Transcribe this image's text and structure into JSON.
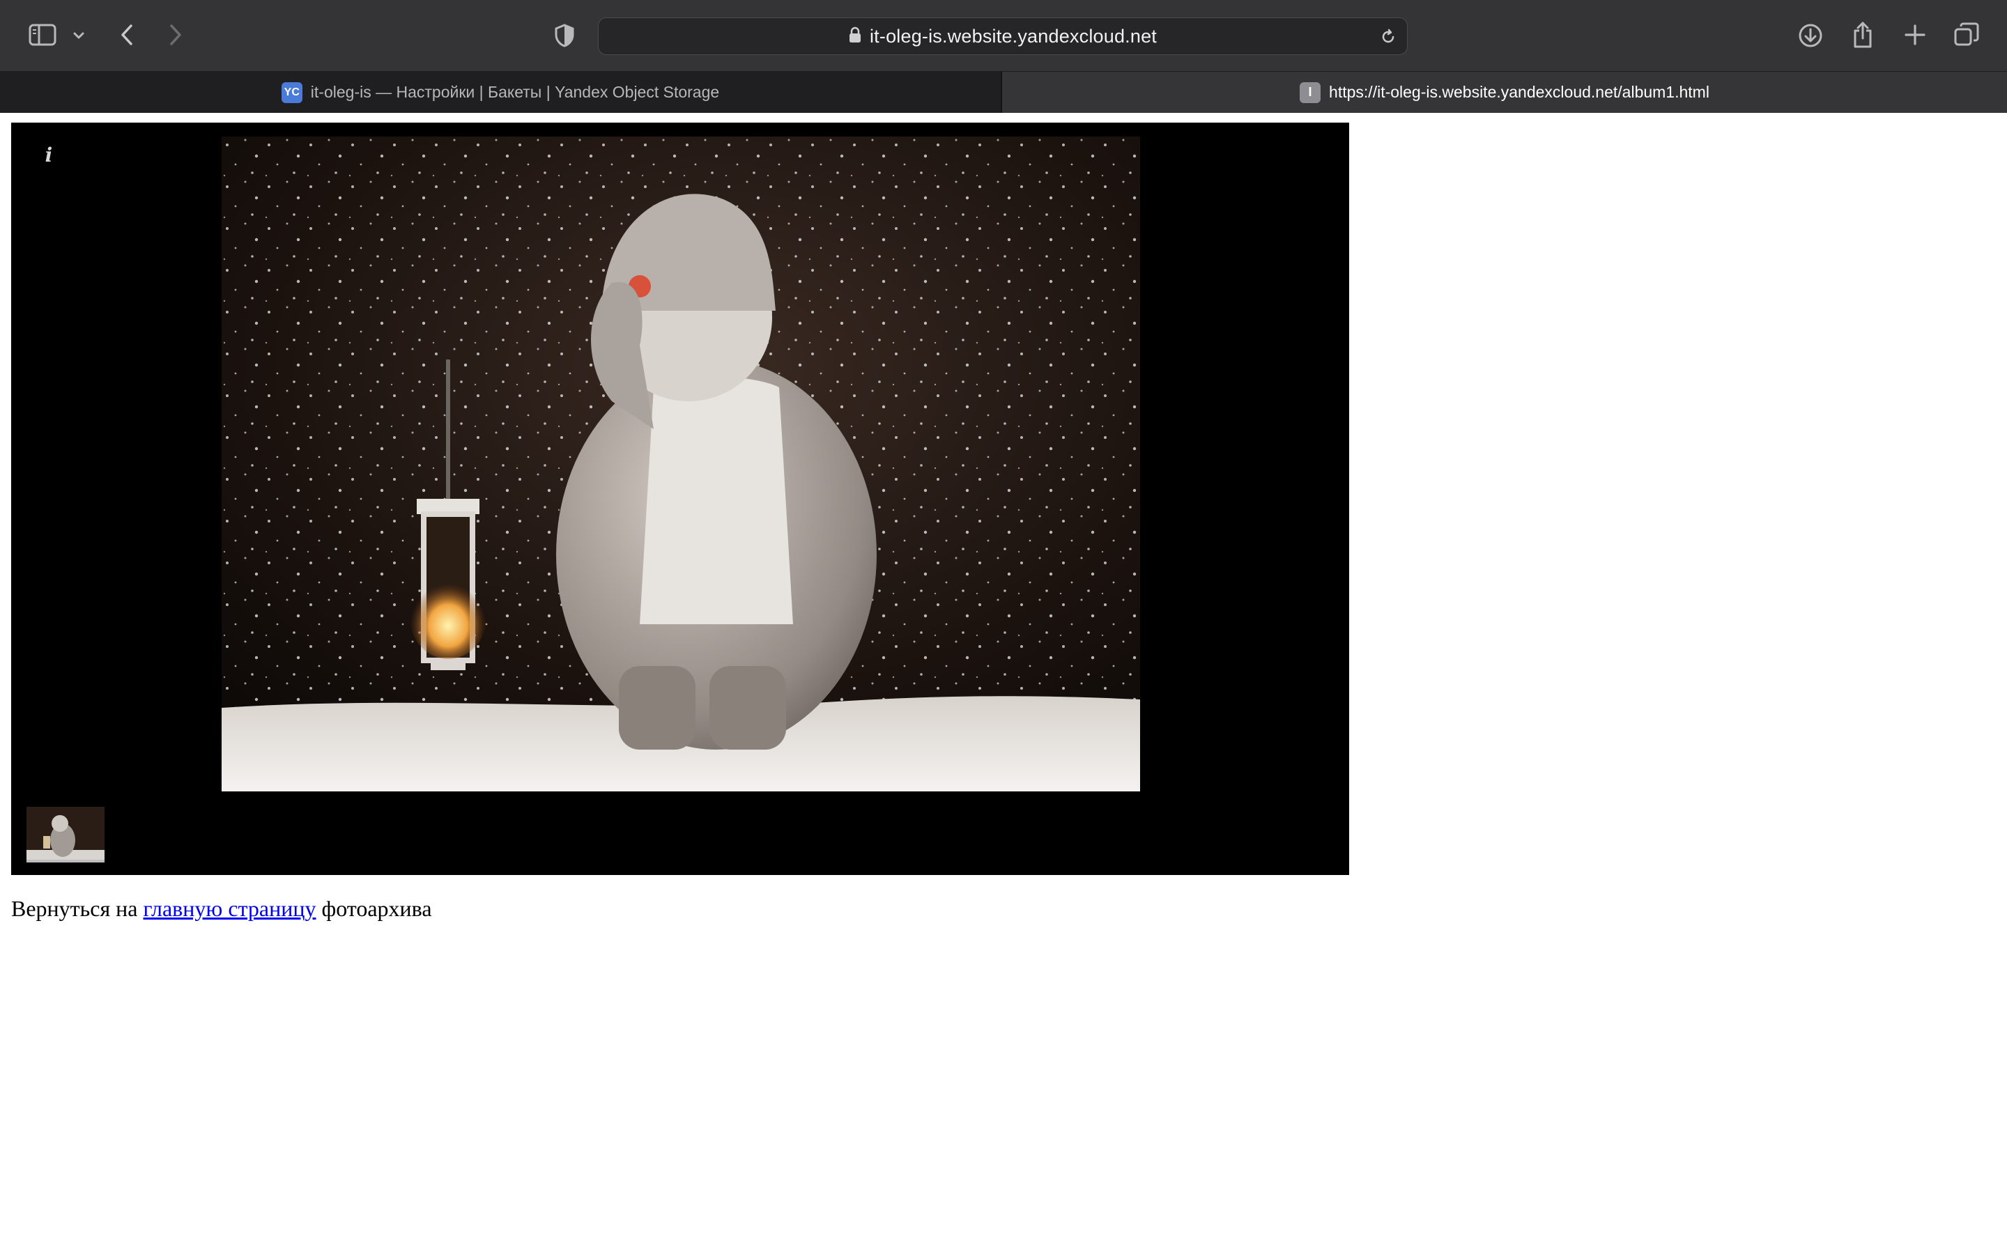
{
  "browser": {
    "url": "it-oleg-is.website.yandexcloud.net",
    "tabs": [
      {
        "favicon": "YC",
        "title": "it-oleg-is — Настройки | Бакеты | Yandex Object Storage",
        "active": false
      },
      {
        "favicon": "I",
        "title": "https://it-oleg-is.website.yandexcloud.net/album1.html",
        "active": true
      }
    ],
    "icons": {
      "sidebar": "sidebar-icon",
      "sidebar_menu": "chevron-down-icon",
      "back": "back-arrow-icon",
      "forward": "forward-arrow-icon",
      "privacy": "shield-icon",
      "lock": "lock-icon",
      "reload": "reload-icon",
      "downloads": "download-icon",
      "share": "share-icon",
      "new_tab": "plus-icon",
      "tab_overview": "tabs-overview-icon"
    }
  },
  "gallery": {
    "info_label": "i",
    "photo_subject": "snowman figurine holding a lantern in falling snow",
    "thumbnail_count": 1
  },
  "footer": {
    "prefix": "Вернуться на",
    "link_text": "главную страницу",
    "suffix": "фотоархива"
  }
}
